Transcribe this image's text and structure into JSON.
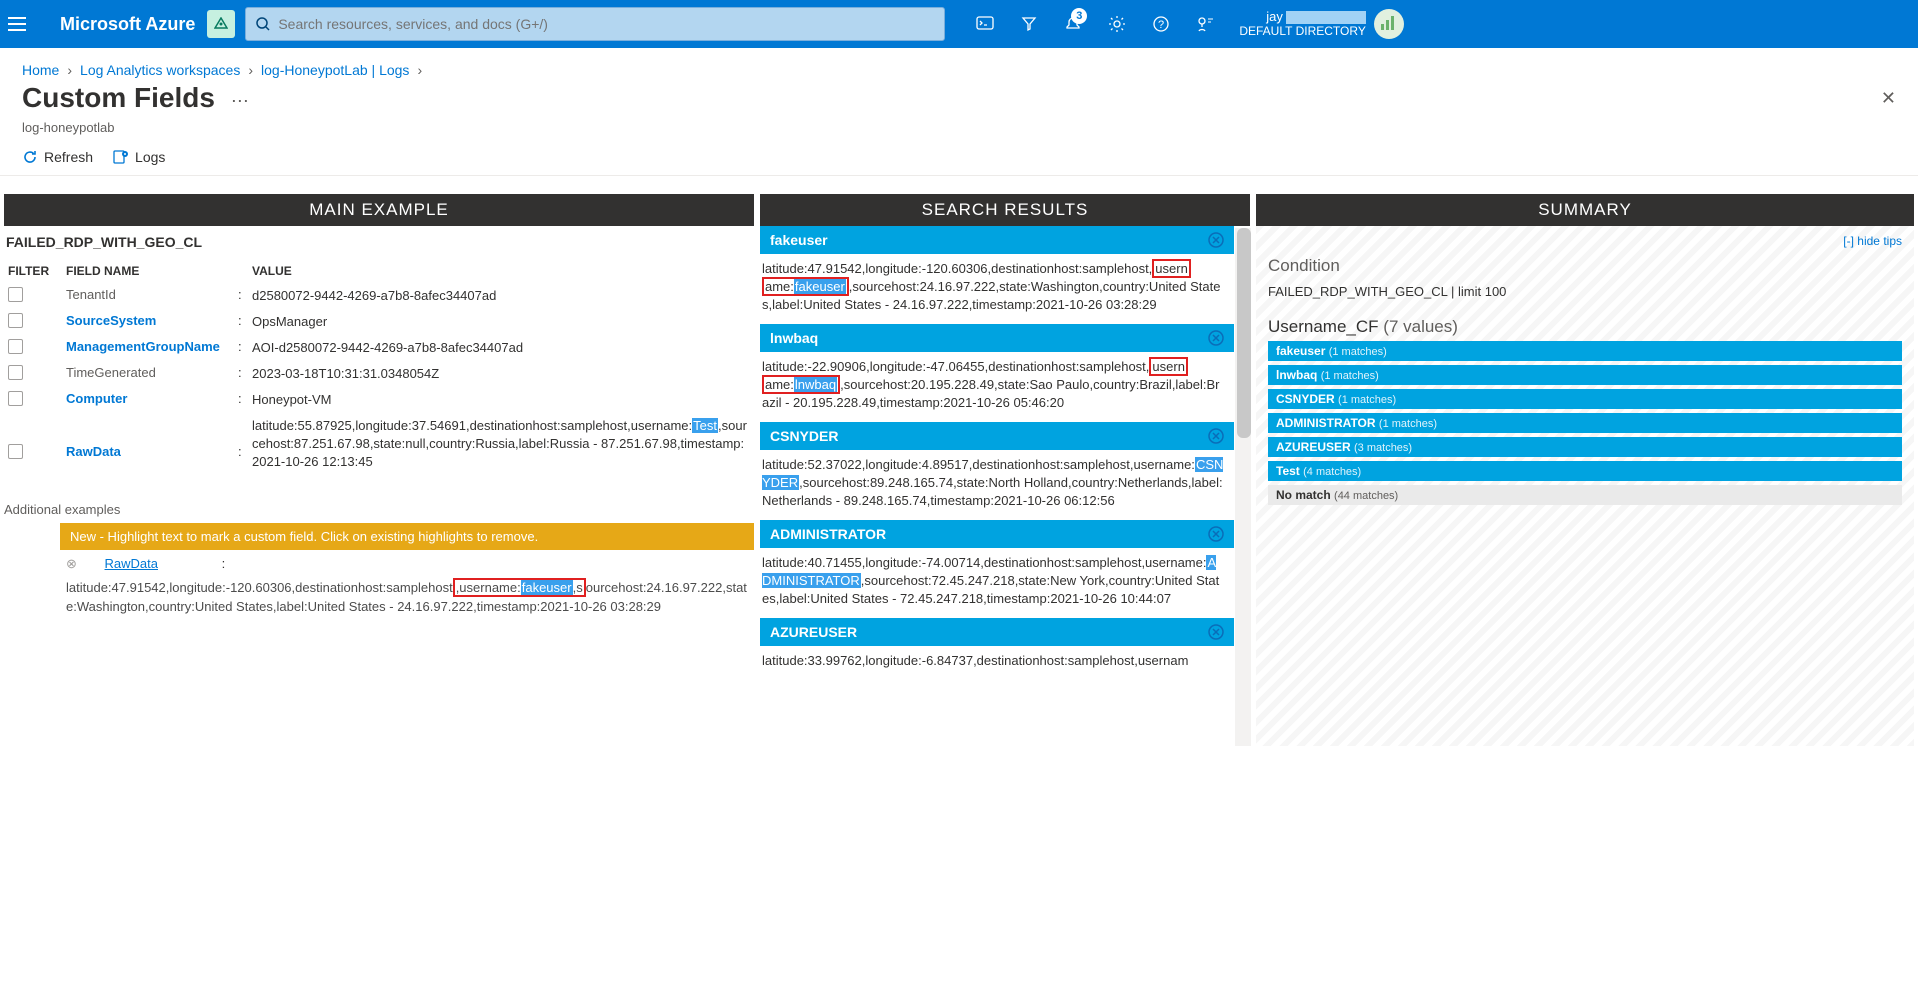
{
  "header": {
    "brand": "Microsoft Azure",
    "search_placeholder": "Search resources, services, and docs (G+/)",
    "notif_count": "3",
    "user_name": "jay",
    "user_dir": "DEFAULT DIRECTORY"
  },
  "breadcrumb": {
    "home": "Home",
    "ws": "Log Analytics workspaces",
    "res": "log-HoneypotLab | Logs"
  },
  "page": {
    "title": "Custom Fields",
    "subtitle": "log-honeypotlab",
    "refresh": "Refresh",
    "logs": "Logs"
  },
  "cols": {
    "main": "MAIN EXAMPLE",
    "search": "SEARCH RESULTS",
    "summary": "SUMMARY"
  },
  "main": {
    "table_name": "FAILED_RDP_WITH_GEO_CL",
    "h_filter": "FILTER",
    "h_field": "FIELD NAME",
    "h_value": "VALUE",
    "rows": [
      {
        "name": "TenantId",
        "value": "d2580072-9442-4269-a7b8-8afec34407ad",
        "link": false
      },
      {
        "name": "SourceSystem",
        "value": "OpsManager",
        "link": true
      },
      {
        "name": "ManagementGroupName",
        "value": "AOI-d2580072-9442-4269-a7b8-8afec34407ad",
        "link": true
      },
      {
        "name": "TimeGenerated",
        "value": "2023-03-18T10:31:31.0348054Z",
        "link": false
      },
      {
        "name": "Computer",
        "value": "Honeypot-VM",
        "link": true
      }
    ],
    "rawdata_label": "RawData",
    "rawdata_pre": "latitude:55.87925,longitude:37.54691,destinationhost:samplehost,username:",
    "rawdata_hl": "Test",
    "rawdata_post": ",sourcehost:87.251.67.98,state:null,country:Russia,label:Russia - 87.251.67.98,timestamp:2021-10-26 12:13:45",
    "additional": "Additional examples",
    "hint": "New - Highlight text to mark a custom field. Click on existing highlights to remove.",
    "add_raw": "RawData",
    "add_pre": "latitude:47.91542,longitude:-120.60306,destinationhost:samplehost",
    "add_mid": ",username:",
    "add_hl": "fakeuser",
    "add_mid2": ",s",
    "add_post": "ourcehost:24.16.97.222,state:Washington,country:United States,label:United States - 24.16.97.222,timestamp:2021-10-26 03:28:29"
  },
  "search": [
    {
      "title": "fakeuser",
      "pre": "latitude:47.91542,longitude:-120.60306,destinationhost:samplehost,",
      "box1": "usern",
      "br": "",
      "box2": "ame:",
      "hl": "fakeuser",
      "post": ",sourcehost:24.16.97.222,state:Washington,country:United States,label:United States - 24.16.97.222,timestamp:2021-10-26 03:28:29"
    },
    {
      "title": "lnwbaq",
      "pre": "latitude:-22.90906,longitude:-47.06455,destinationhost:samplehost,",
      "box1": "usern",
      "br": "",
      "box2": "ame:",
      "hl": "lnwbaq",
      "post": ",sourcehost:20.195.228.49,state:Sao Paulo,country:Brazil,label:Brazil - 20.195.228.49,timestamp:2021-10-26 05:46:20"
    },
    {
      "title": "CSNYDER",
      "pre": "latitude:52.37022,longitude:4.89517,destinationhost:samplehost,username:",
      "hl": "CSNYDER",
      "post": ",sourcehost:89.248.165.74,state:North Holland,country:Netherlands,label:Netherlands - 89.248.165.74,timestamp:2021-10-26 06:12:56"
    },
    {
      "title": "ADMINISTRATOR",
      "pre": "latitude:40.71455,longitude:-74.00714,destinationhost:samplehost,username:",
      "hl": "ADMINISTRATOR",
      "post": ",sourcehost:72.45.247.218,state:New York,country:United States,label:United States - 72.45.247.218,timestamp:2021-10-26 10:44:07"
    },
    {
      "title": "AZUREUSER",
      "pre": "latitude:33.99762,longitude:-6.84737,destinationhost:samplehost,usernam",
      "hl": "",
      "post": ""
    }
  ],
  "summary": {
    "hide_tips": "[-] hide tips",
    "cond_label": "Condition",
    "cond_value": "FAILED_RDP_WITH_GEO_CL | limit 100",
    "field_name": "Username_CF",
    "field_count": "(7 values)",
    "values": [
      {
        "name": "fakeuser",
        "m": "(1 matches)"
      },
      {
        "name": "lnwbaq",
        "m": "(1 matches)"
      },
      {
        "name": "CSNYDER",
        "m": "(1 matches)"
      },
      {
        "name": "ADMINISTRATOR",
        "m": "(1 matches)"
      },
      {
        "name": "AZUREUSER",
        "m": "(3 matches)"
      },
      {
        "name": "Test",
        "m": "(4 matches)"
      }
    ],
    "nomatch_name": "No match",
    "nomatch_m": "(44 matches)"
  }
}
